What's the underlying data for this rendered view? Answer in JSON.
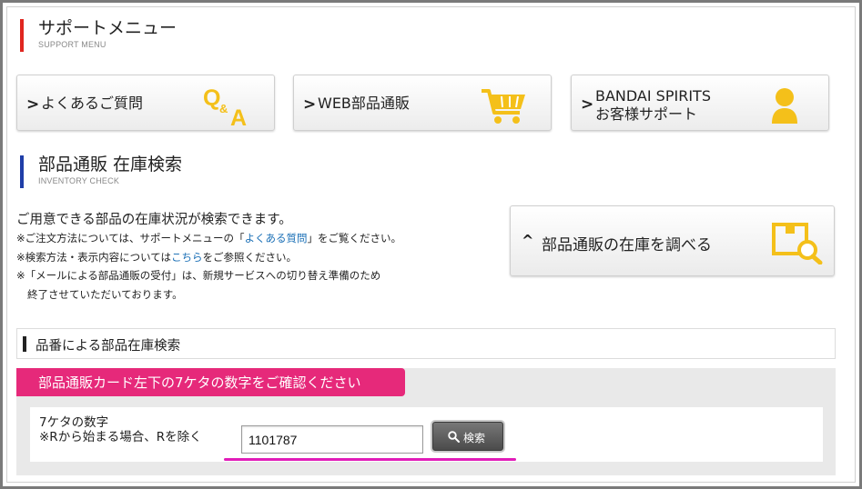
{
  "colors": {
    "support_bar": "#e0261f",
    "inventory_bar": "#1f3ea8",
    "icon_yellow": "#f4c01a",
    "pink_banner": "#e6297a",
    "link": "#1a6fb6",
    "highlight_underline": "#e11cb8"
  },
  "support_menu": {
    "title": "サポートメニュー",
    "subtitle": "SUPPORT MENU",
    "buttons": [
      {
        "label": "よくあるご質問",
        "icon": "qa-icon"
      },
      {
        "label": "WEB部品通販",
        "icon": "cart-icon"
      },
      {
        "label_line1": "BANDAI SPIRITS",
        "label_line2": "お客様サポート",
        "icon": "person-icon"
      }
    ],
    "chevron": ">"
  },
  "inventory": {
    "title": "部品通販 在庫検索",
    "subtitle": "INVENTORY CHECK",
    "lead": "ご用意できる部品の在庫状況が検索できます。",
    "note1_prefix": "※ご注文方法については、サポートメニューの「",
    "note1_link": "よくある質問",
    "note1_suffix": "」をご覧ください。",
    "note2_prefix": "※検索方法・表示内容については",
    "note2_link": "こちら",
    "note2_suffix": "をご参照ください。",
    "note3_line1": "※「メールによる部品通販の受付」は、新規サービスへの切り替え準備のため",
    "note3_line2": "終了させていただいております。",
    "check_button_chevron": "^",
    "check_button_label": "部品通販の在庫を調べる",
    "check_button_icon": "box-search-icon"
  },
  "part_search": {
    "title": "品番による部品在庫検索",
    "banner": "部品通販カード左下の7ケタの数字をご確認ください",
    "field_label_line1": "7ケタの数字",
    "field_label_line2": "※Rから始まる場合、Rを除く",
    "input_value": "1101787",
    "search_button": "検索",
    "search_icon": "magnifier-icon"
  }
}
